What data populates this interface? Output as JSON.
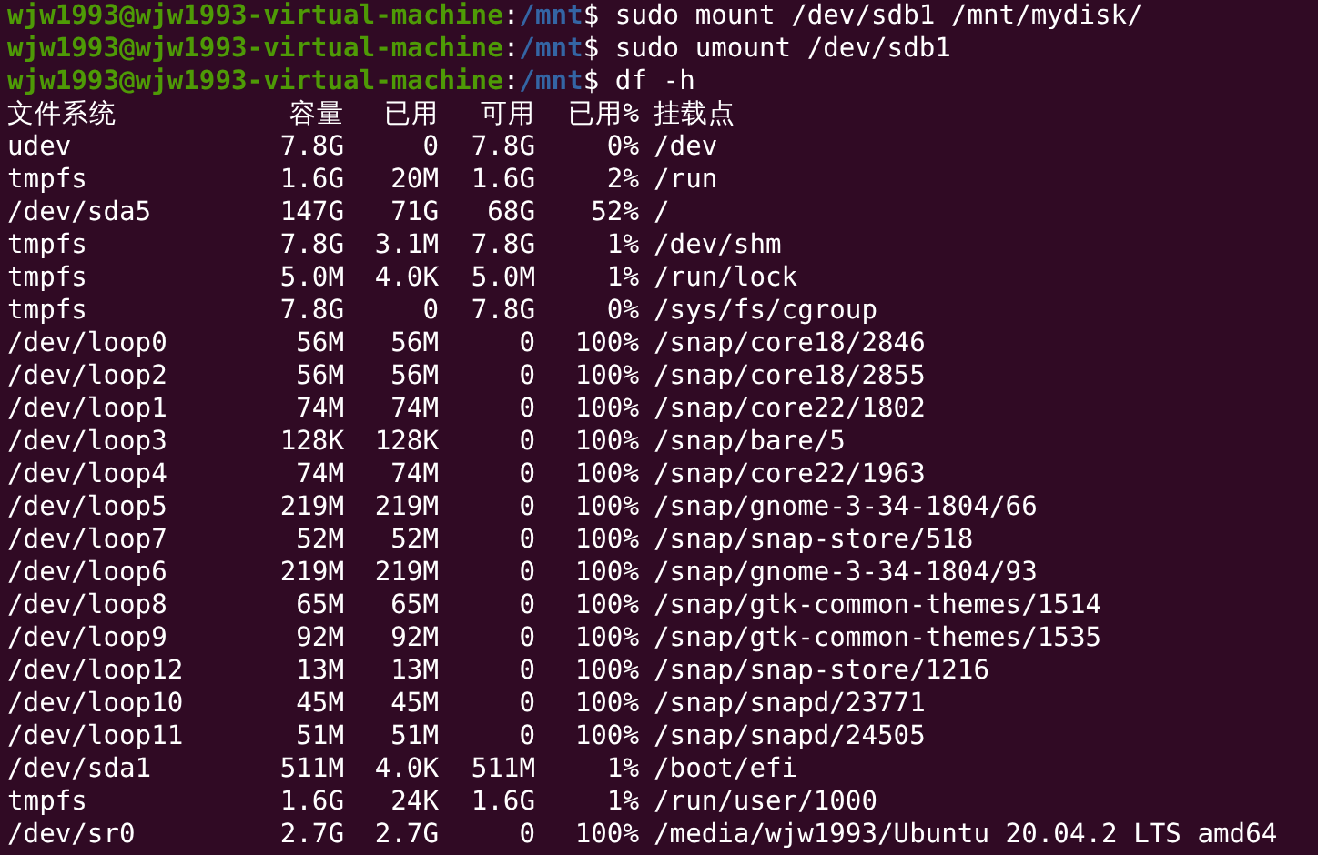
{
  "prompts": [
    {
      "user_host": "wjw1993@wjw1993-virtual-machine",
      "separator": ":",
      "path": "/mnt",
      "symbol": "$",
      "command": "sudo mount /dev/sdb1 /mnt/mydisk/"
    },
    {
      "user_host": "wjw1993@wjw1993-virtual-machine",
      "separator": ":",
      "path": "/mnt",
      "symbol": "$",
      "command": "sudo umount /dev/sdb1"
    },
    {
      "user_host": "wjw1993@wjw1993-virtual-machine",
      "separator": ":",
      "path": "/mnt",
      "symbol": "$",
      "command": "df -h"
    }
  ],
  "table": {
    "columns": [
      "文件系统",
      "容量",
      "已用",
      "可用",
      "已用%",
      "挂载点"
    ],
    "rows": [
      [
        "udev",
        "7.8G",
        "0",
        "7.8G",
        "0%",
        "/dev"
      ],
      [
        "tmpfs",
        "1.6G",
        "20M",
        "1.6G",
        "2%",
        "/run"
      ],
      [
        "/dev/sda5",
        "147G",
        "71G",
        "68G",
        "52%",
        "/"
      ],
      [
        "tmpfs",
        "7.8G",
        "3.1M",
        "7.8G",
        "1%",
        "/dev/shm"
      ],
      [
        "tmpfs",
        "5.0M",
        "4.0K",
        "5.0M",
        "1%",
        "/run/lock"
      ],
      [
        "tmpfs",
        "7.8G",
        "0",
        "7.8G",
        "0%",
        "/sys/fs/cgroup"
      ],
      [
        "/dev/loop0",
        "56M",
        "56M",
        "0",
        "100%",
        "/snap/core18/2846"
      ],
      [
        "/dev/loop2",
        "56M",
        "56M",
        "0",
        "100%",
        "/snap/core18/2855"
      ],
      [
        "/dev/loop1",
        "74M",
        "74M",
        "0",
        "100%",
        "/snap/core22/1802"
      ],
      [
        "/dev/loop3",
        "128K",
        "128K",
        "0",
        "100%",
        "/snap/bare/5"
      ],
      [
        "/dev/loop4",
        "74M",
        "74M",
        "0",
        "100%",
        "/snap/core22/1963"
      ],
      [
        "/dev/loop5",
        "219M",
        "219M",
        "0",
        "100%",
        "/snap/gnome-3-34-1804/66"
      ],
      [
        "/dev/loop7",
        "52M",
        "52M",
        "0",
        "100%",
        "/snap/snap-store/518"
      ],
      [
        "/dev/loop6",
        "219M",
        "219M",
        "0",
        "100%",
        "/snap/gnome-3-34-1804/93"
      ],
      [
        "/dev/loop8",
        "65M",
        "65M",
        "0",
        "100%",
        "/snap/gtk-common-themes/1514"
      ],
      [
        "/dev/loop9",
        "92M",
        "92M",
        "0",
        "100%",
        "/snap/gtk-common-themes/1535"
      ],
      [
        "/dev/loop12",
        "13M",
        "13M",
        "0",
        "100%",
        "/snap/snap-store/1216"
      ],
      [
        "/dev/loop10",
        "45M",
        "45M",
        "0",
        "100%",
        "/snap/snapd/23771"
      ],
      [
        "/dev/loop11",
        "51M",
        "51M",
        "0",
        "100%",
        "/snap/snapd/24505"
      ],
      [
        "/dev/sda1",
        "511M",
        "4.0K",
        "511M",
        "1%",
        "/boot/efi"
      ],
      [
        "tmpfs",
        "1.6G",
        "24K",
        "1.6G",
        "1%",
        "/run/user/1000"
      ],
      [
        "/dev/sr0",
        "2.7G",
        "2.7G",
        "0",
        "100%",
        "/media/wjw1993/Ubuntu 20.04.2 LTS amd64"
      ]
    ]
  }
}
